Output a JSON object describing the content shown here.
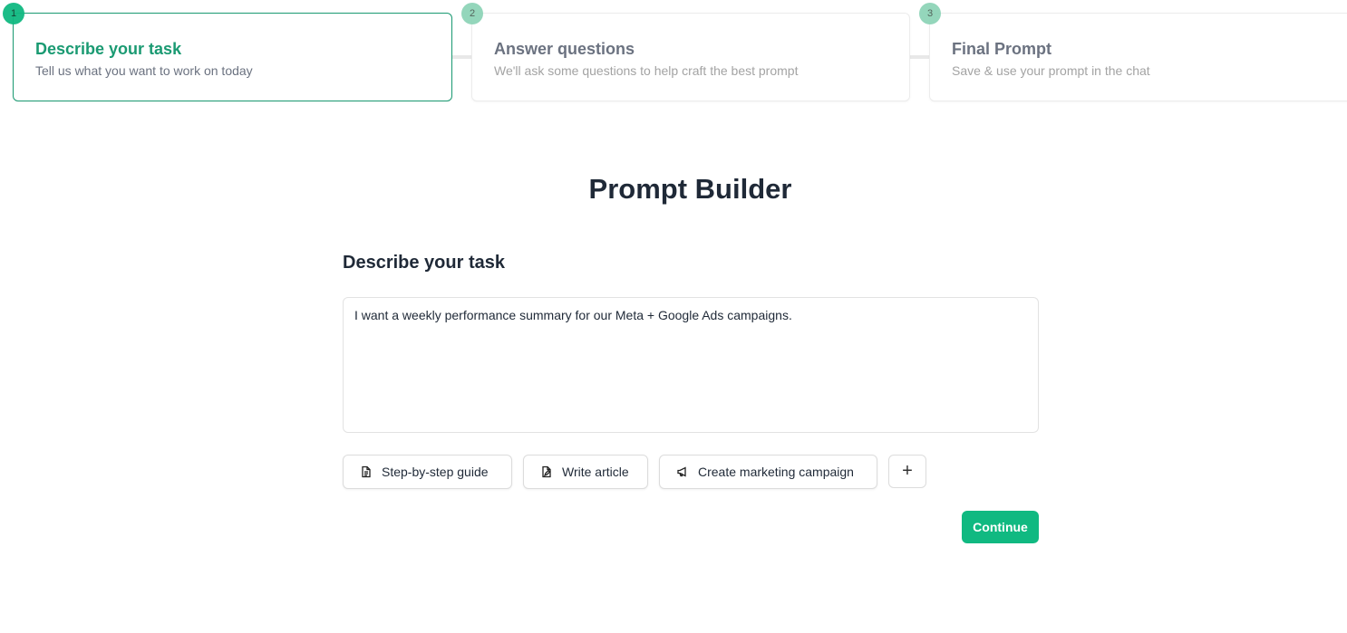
{
  "stepper": {
    "steps": [
      {
        "number": "1",
        "title": "Describe your task",
        "subtitle": "Tell us what you want to work on today"
      },
      {
        "number": "2",
        "title": "Answer questions",
        "subtitle": "We'll ask some questions to help craft the best prompt"
      },
      {
        "number": "3",
        "title": "Final Prompt",
        "subtitle": "Save & use your prompt in the chat"
      }
    ],
    "active_step": 1
  },
  "main": {
    "title": "Prompt Builder",
    "section_label": "Describe your task",
    "task_input": {
      "value": "I want a weekly performance summary for our Meta + Google Ads campaigns."
    },
    "suggestions": [
      {
        "label": "Step-by-step guide",
        "icon": "document-icon"
      },
      {
        "label": "Write article",
        "icon": "file-pen-icon"
      },
      {
        "label": "Create marketing campaign",
        "icon": "megaphone-icon"
      }
    ],
    "add_suggestion_symbol": "+",
    "continue_label": "Continue"
  },
  "colors": {
    "accent": "#10b981",
    "accent_dark": "#1a9a72",
    "text_primary": "#1f2937",
    "text_muted": "#a3a3a3"
  }
}
